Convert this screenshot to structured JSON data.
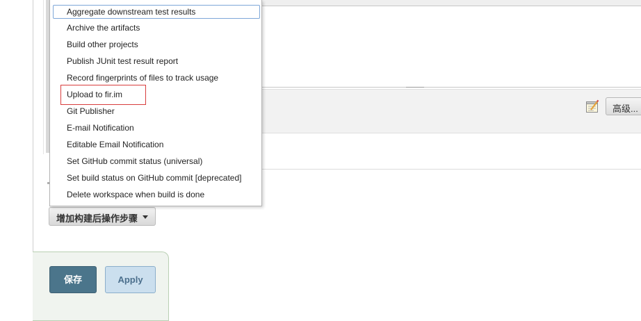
{
  "menu": {
    "items": [
      "Aggregate downstream test results",
      "Archive the artifacts",
      "Build other projects",
      "Publish JUnit test result report",
      "Record fingerprints of files to track usage",
      "Upload to fir.im",
      "Git Publisher",
      "E-mail Notification",
      "Editable Email Notification",
      "Set GitHub commit status (universal)",
      "Set build status on GitHub commit [deprecated]",
      "Delete workspace when build is done"
    ],
    "focused_index": 0,
    "highlighted_index": 5
  },
  "buttons": {
    "advanced_label": "高级...",
    "add_post_build_label": "增加构建后操作步骤",
    "save_label": "保存",
    "apply_label": "Apply"
  },
  "colors": {
    "save_bg": "#4b758b",
    "apply_bg": "#cbdfee",
    "highlight_border": "#d83c3c",
    "focus_border": "#7ea7d8"
  },
  "icons": {
    "advanced_notes": "notepad-icon",
    "dropdown_caret": "caret-down-icon"
  }
}
